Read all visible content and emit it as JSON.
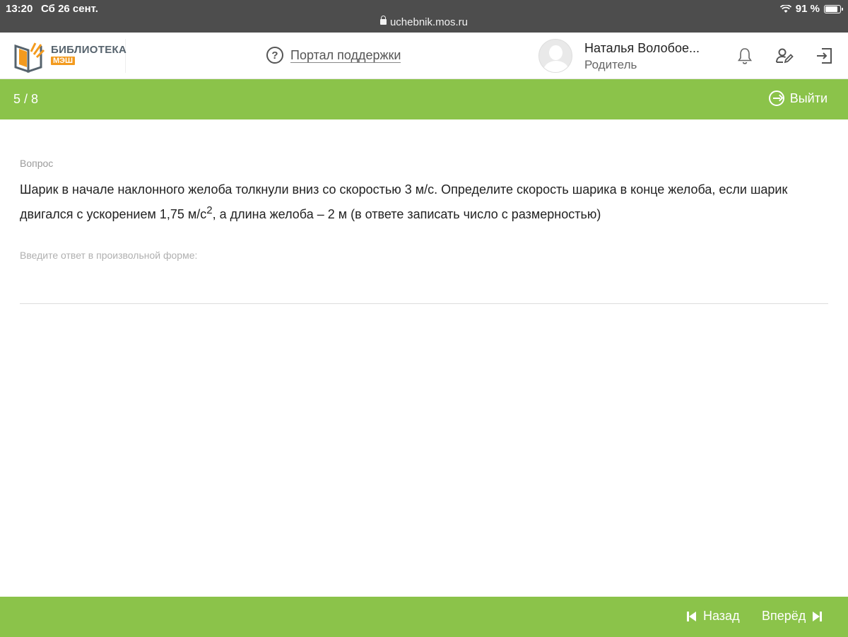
{
  "status_bar": {
    "time": "13:20",
    "date": "Сб 26 сент.",
    "url": "uchebnik.mos.ru",
    "battery": "91 %",
    "battery_level": 0.91
  },
  "header": {
    "logo_title": "БИБЛИОТЕКА",
    "logo_subtitle": "МЭШ",
    "support_label": "Портал поддержки",
    "user_name": "Наталья Волобое...",
    "user_role": "Родитель",
    "icons": [
      "bell-icon",
      "user-edit-icon",
      "logout-icon"
    ]
  },
  "topbar": {
    "counter": "5 / 8",
    "exit_label": "Выйти"
  },
  "question": {
    "label": "Вопрос",
    "text_part1": "Шарик в начале наклонного желоба толкнули вниз со скоростью 3 м/с. Определите скорость шарика в конце желоба, если шарик двигался с ускорением 1,75 м/с",
    "superscript": "2",
    "text_part2": ", а длина желоба – 2 м (в ответе записать число с размерностью)"
  },
  "answer": {
    "label": "Введите ответ в произвольной форме:",
    "value": ""
  },
  "navigation": {
    "back_label": "Назад",
    "forward_label": "Вперёд"
  },
  "colors": {
    "accent_green": "#8bc34a",
    "statusbar": "#4d4d4d",
    "logo_orange": "#f39a1e"
  }
}
